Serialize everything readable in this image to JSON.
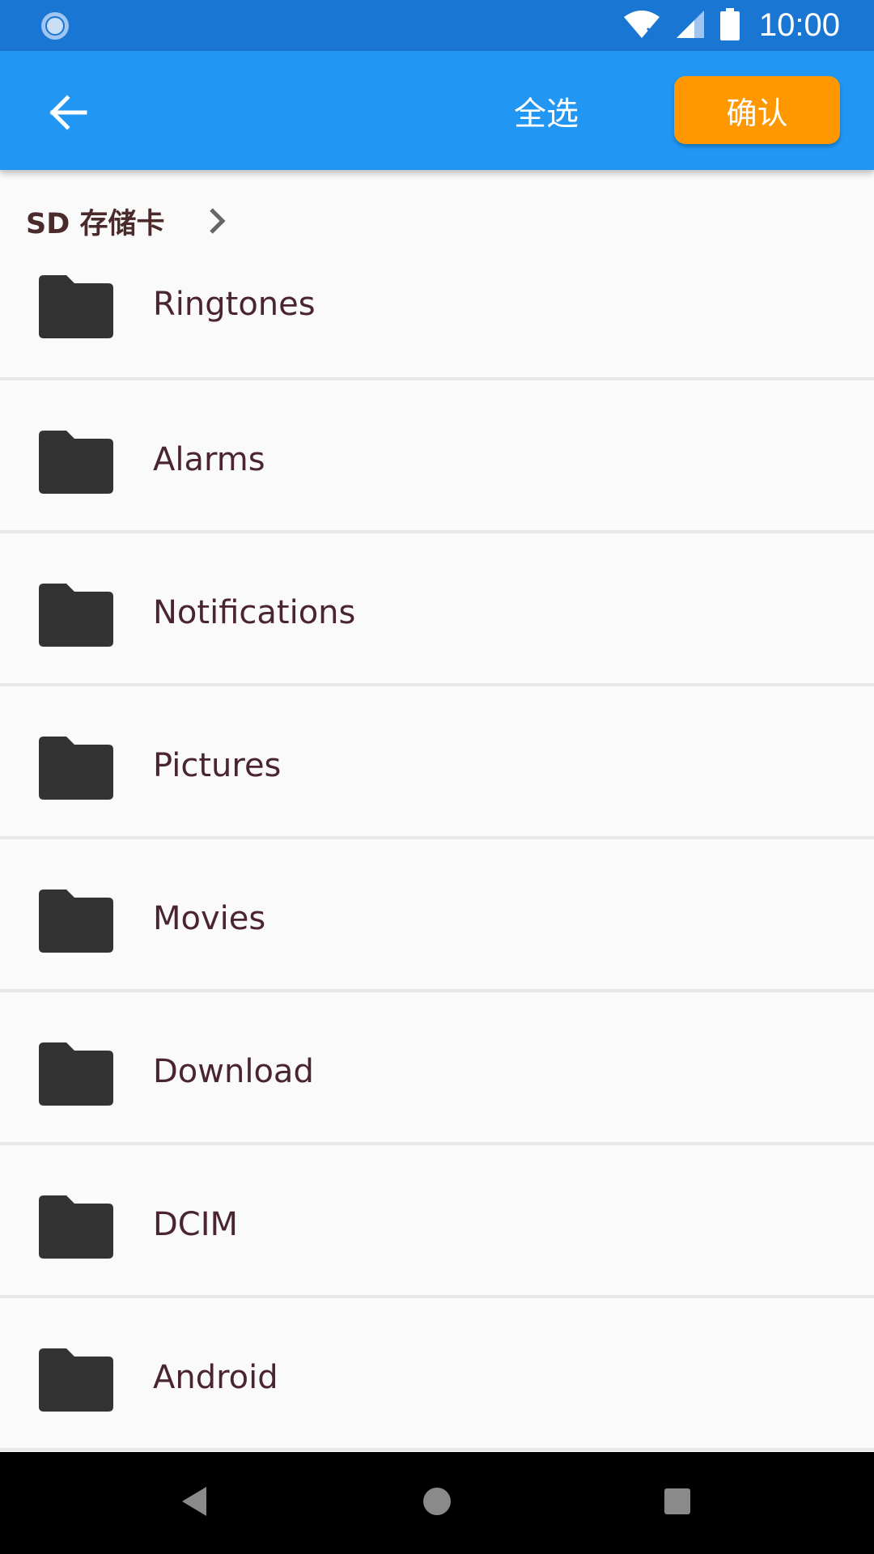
{
  "status_bar": {
    "time": "10:00",
    "icons": [
      "loading-icon",
      "wifi-icon",
      "signal-icon",
      "battery-icon"
    ]
  },
  "app_bar": {
    "back_icon": "back-arrow-icon",
    "select_all_label": "全选",
    "confirm_label": "确认",
    "colors": {
      "status_bar": "#1976d2",
      "app_bar": "#2196f3",
      "confirm_button": "#ff9800"
    }
  },
  "breadcrumb": {
    "label": "SD 存储卡",
    "chevron_icon": "chevron-right-icon"
  },
  "folders": [
    {
      "name": "Ringtones",
      "icon": "folder-icon"
    },
    {
      "name": "Alarms",
      "icon": "folder-icon"
    },
    {
      "name": "Notifications",
      "icon": "folder-icon"
    },
    {
      "name": "Pictures",
      "icon": "folder-icon"
    },
    {
      "name": "Movies",
      "icon": "folder-icon"
    },
    {
      "name": "Download",
      "icon": "folder-icon"
    },
    {
      "name": "DCIM",
      "icon": "folder-icon"
    },
    {
      "name": "Android",
      "icon": "folder-icon"
    }
  ],
  "nav_bar": {
    "icons": [
      "nav-back-icon",
      "nav-home-icon",
      "nav-recents-icon"
    ]
  }
}
